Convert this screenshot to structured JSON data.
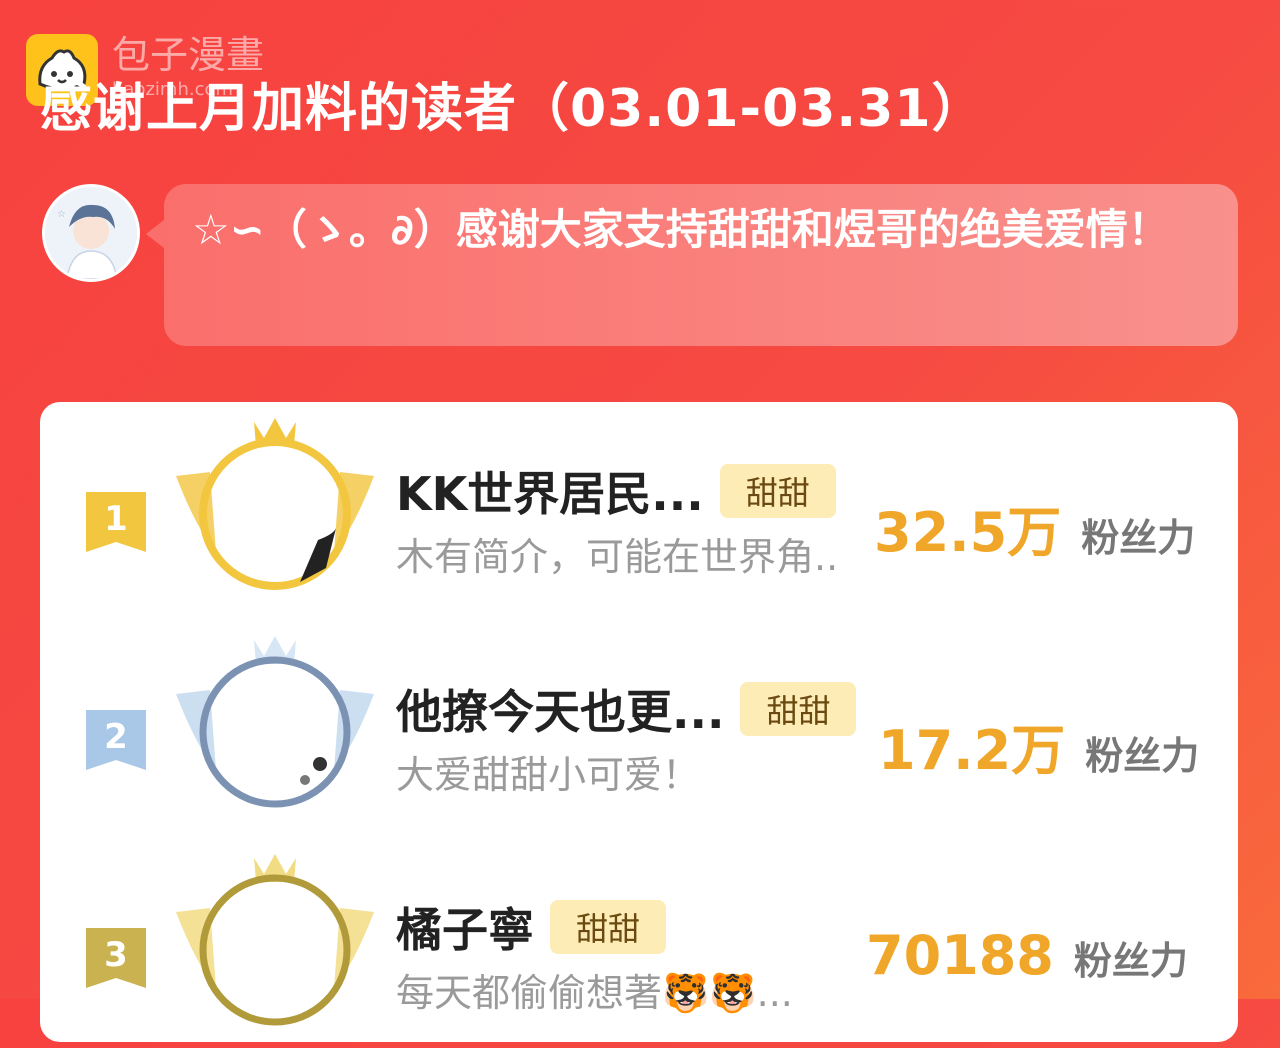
{
  "watermark": {
    "brand": "包子漫畫",
    "domain": "baozimh.com"
  },
  "header": {
    "title": "感谢上月加料的读者（03.01-03.31）"
  },
  "author_message": {
    "text": "☆∽（ゝ。∂）感谢大家支持甜甜和煜哥的绝美爱情！"
  },
  "leaderboard": {
    "entries": [
      {
        "rank": "1",
        "name": "KK世界居民...",
        "badge": "甜甜",
        "bio": "木有简介，可能在世界角..",
        "score": "32.5万",
        "score_unit": "粉丝力",
        "color": "#f3c63f"
      },
      {
        "rank": "2",
        "name": "他撩今天也更...",
        "badge": "甜甜",
        "bio": "大爱甜甜小可爱！",
        "score": "17.2万",
        "score_unit": "粉丝力",
        "color": "#a9c7e6"
      },
      {
        "rank": "3",
        "name": "橘子寧",
        "badge": "甜甜",
        "bio": "每天都偷偷想著🐯🐯...",
        "score": "70188",
        "score_unit": "粉丝力",
        "color": "#c9b24f"
      }
    ]
  },
  "colors": {
    "accent": "#f0a628",
    "background": "#f64a42",
    "badge_bg": "#fdecb5"
  }
}
